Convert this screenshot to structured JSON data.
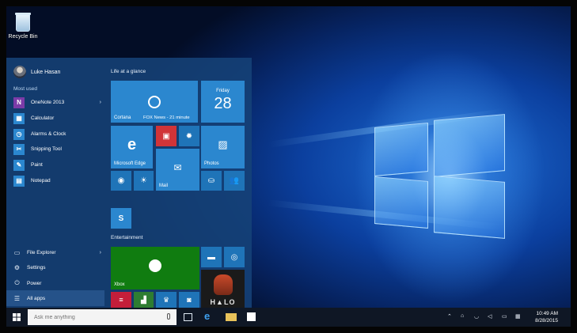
{
  "desktop": {
    "recycle_bin_label": "Recycle Bin"
  },
  "start_menu": {
    "user_name": "Luke Hasan",
    "most_used_label": "Most used",
    "apps": [
      {
        "name": "OneNote 2013",
        "icon": "onenote-icon",
        "has_arrow": true
      },
      {
        "name": "Calculator",
        "icon": "calculator-icon"
      },
      {
        "name": "Alarms & Clock",
        "icon": "alarm-clock-icon"
      },
      {
        "name": "Snipping Tool",
        "icon": "scissors-icon"
      },
      {
        "name": "Paint",
        "icon": "paint-palette-icon"
      },
      {
        "name": "Notepad",
        "icon": "notepad-icon"
      }
    ],
    "system": [
      {
        "name": "File Explorer",
        "icon": "folder-icon",
        "has_arrow": true
      },
      {
        "name": "Settings",
        "icon": "gear-icon"
      },
      {
        "name": "Power",
        "icon": "power-icon"
      },
      {
        "name": "All apps",
        "icon": "list-icon"
      }
    ],
    "groups": {
      "life": "Life at a glance",
      "entertainment": "Entertainment"
    },
    "tiles": {
      "cortana": "Cortana",
      "news": "FOX News - 21 minute",
      "calendar_day": "Friday",
      "calendar_date": "28",
      "edge": "Microsoft Edge",
      "photos": "Photos",
      "mail": "Mail",
      "xbox": "Xbox"
    }
  },
  "taskbar": {
    "search_placeholder": "Ask me anything",
    "time": "10:49 AM",
    "date": "8/28/2015"
  },
  "colors": {
    "accent": "#2b87cf",
    "xbox_green": "#107c10",
    "taskbar": "#0f1725"
  }
}
